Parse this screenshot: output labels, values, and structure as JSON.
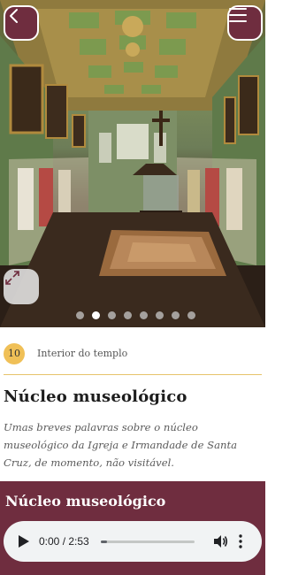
{
  "hero": {
    "image_alt": "Núcleo museológico",
    "back_icon": "chevron-left-icon",
    "menu_icon": "hamburger-icon",
    "expand_icon": "expand-icon",
    "slide_count": 8,
    "active_slide": 1
  },
  "stop": {
    "number": "10",
    "label": "Interior do templo"
  },
  "section": {
    "title": "Núcleo museológico",
    "description": "Umas breves palavras sobre o núcleo museológico da Igreja e Irmandade de Santa Cruz, de momento, não visitável."
  },
  "audio": {
    "title": "Núcleo museológico",
    "current_time": "0:00",
    "duration": "2:53",
    "time_display": "0:00 / 2:53",
    "progress": 0.07
  },
  "colors": {
    "brand": "#6f2d3f",
    "badge": "#f0c057",
    "divider": "#e6c36a"
  }
}
